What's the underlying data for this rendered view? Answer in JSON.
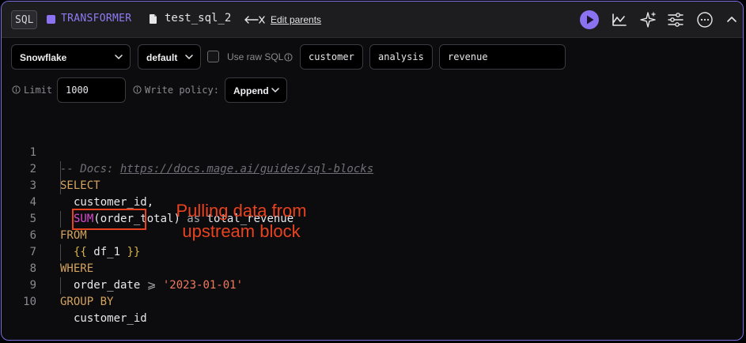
{
  "header": {
    "language": "SQL",
    "block_type": "TRANSFORMER",
    "block_name": "test_sql_2",
    "edit_parents": "Edit parents",
    "icons": [
      "file-icon",
      "parents-arrow-icon",
      "play-icon",
      "chart-icon",
      "sparkle-icon",
      "settings-sliders-icon",
      "more-icon",
      "chevron-up-icon"
    ],
    "accent_color": "#8a72f0"
  },
  "controls": {
    "connection": "Snowflake",
    "profile": "default",
    "use_raw_sql_label": "Use raw SQL",
    "use_raw_sql_checked": false,
    "database": "customer",
    "schema": "analysis",
    "table": "revenue",
    "limit_label": "Limit",
    "limit_value": "1000",
    "write_policy_label": "Write policy:",
    "write_policy": "Append"
  },
  "code": {
    "line_numbers": [
      "1",
      "2",
      "3",
      "4",
      "5",
      "6",
      "7",
      "8",
      "9",
      "10"
    ],
    "comment_prefix": "-- Docs: ",
    "comment_link": "https://docs.mage.ai/guides/sql-blocks",
    "kw_select": "SELECT",
    "col_customer_id": "customer_id,",
    "fn_sum": "SUM",
    "sum_args": "(order_total)",
    "kw_as": " as ",
    "alias": "total_revenue",
    "kw_from": "FROM",
    "brace_open": "{{",
    "template_var": " df_1 ",
    "brace_close": "}}",
    "kw_where": "WHERE",
    "where_col": "order_date ",
    "where_op": "⩾",
    "where_val": " '2023-01-01'",
    "kw_group_by": "GROUP BY",
    "group_col": "customer_id"
  },
  "annotation": {
    "line1": "Pulling data from",
    "line2": "upstream block",
    "color": "#e8421f"
  }
}
